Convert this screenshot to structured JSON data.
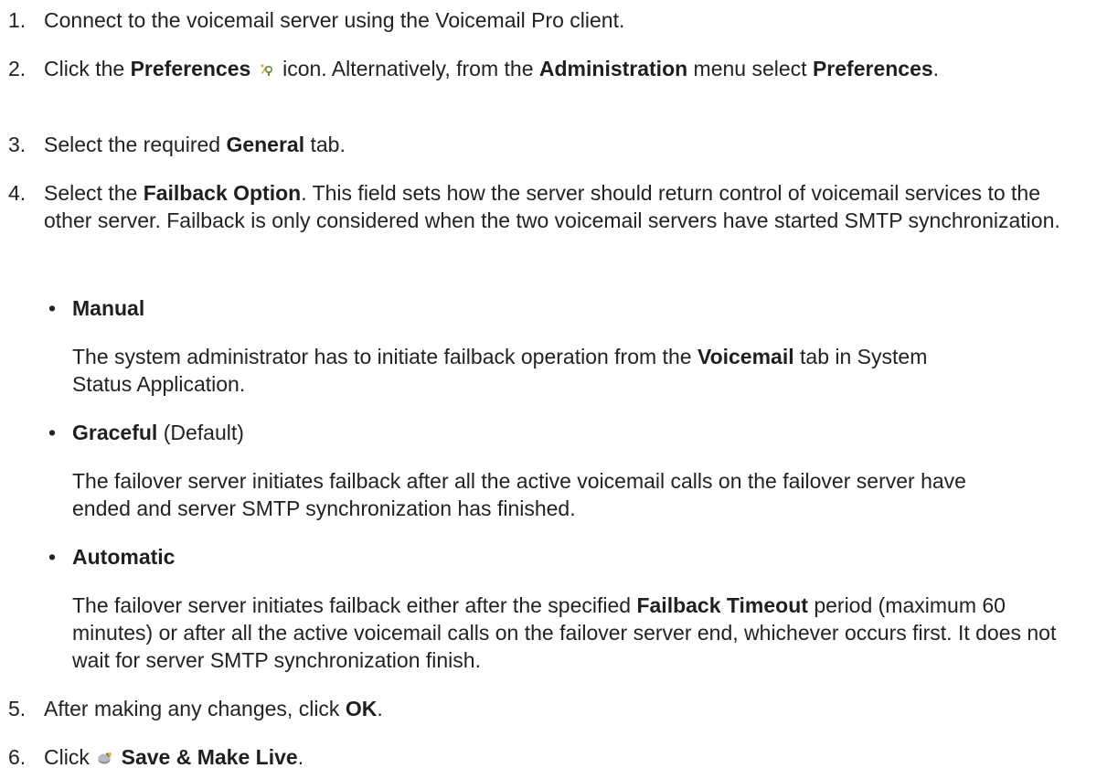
{
  "steps": [
    {
      "number": "1.",
      "text": "Connect to the voicemail server using the Voicemail Pro client."
    },
    {
      "number": "2.",
      "t1": "Click the ",
      "b1": "Preferences",
      "t2": " icon. Alternatively, from the ",
      "b2": "Administration",
      "t3": " menu select ",
      "b3": "Preferences",
      "t4": "."
    },
    {
      "number": "3.",
      "t1": "Select the required ",
      "b1": "General",
      "t2": " tab."
    },
    {
      "number": "4.",
      "t1": "Select the ",
      "b1": "Failback Option",
      "t2": ". This field sets how the server should return control of voicemail services to the other server. Failback is only considered when the two voicemail servers have started SMTP synchronization."
    },
    {
      "number": "5.",
      "t1": "After making any changes, click ",
      "b1": "OK",
      "t2": "."
    },
    {
      "number": "6.",
      "t1": "Click ",
      "b1": "Save & Make Live",
      "t2": "."
    }
  ],
  "options": [
    {
      "bullet": "•",
      "title": "Manual",
      "suffix": "",
      "d1": "The system administrator has to initiate failback operation from the ",
      "db": "Voicemail",
      "d2": " tab in System Status Application."
    },
    {
      "bullet": "•",
      "title": "Graceful",
      "suffix": " (Default)",
      "d1": "The failover server initiates failback after all the active voicemail calls on the failover server have ended and server SMTP synchronization has finished."
    },
    {
      "bullet": "•",
      "title": "Automatic",
      "suffix": "",
      "d1": "The failover server initiates failback either after the specified ",
      "db": "Failback Timeout",
      "d2": " period (maximum 60 minutes) or after all the active voicemail calls on the failover server end, whichever occurs first. It does not wait for server SMTP synchronization finish."
    }
  ],
  "icons": {
    "preferences": "preferences-icon",
    "save": "save-make-live-icon"
  }
}
